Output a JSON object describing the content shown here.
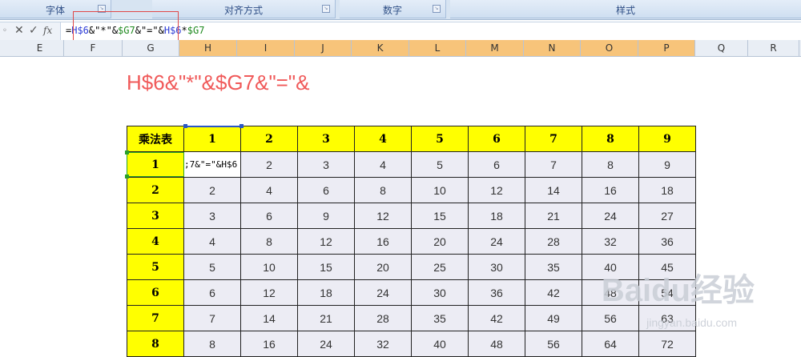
{
  "ribbon": {
    "groups": [
      "字体",
      "对齐方式",
      "数字",
      "样式"
    ]
  },
  "formula_bar": {
    "parts": [
      {
        "text": "=",
        "color": "#000000"
      },
      {
        "text": "H$6",
        "color": "#2b3bd6"
      },
      {
        "text": "&\"*\"&",
        "color": "#000000"
      },
      {
        "text": "$G7",
        "color": "#1f8a1f"
      },
      {
        "text": "&\"=\"&",
        "color": "#000000"
      },
      {
        "text": "H$6",
        "color": "#2b3bd6"
      },
      {
        "text": "*",
        "color": "#000000"
      },
      {
        "text": "$G7",
        "color": "#1f8a1f"
      }
    ]
  },
  "columns": [
    "E",
    "F",
    "G",
    "H",
    "I",
    "J",
    "K",
    "L",
    "M",
    "N",
    "O",
    "P",
    "Q",
    "R"
  ],
  "highlighted_columns": [
    "H",
    "I",
    "J",
    "K",
    "L",
    "M",
    "N",
    "O",
    "P"
  ],
  "big_text": "H$6&\"*\"&$G7&\"=\"&",
  "table": {
    "corner": "乘法表",
    "header": [
      "1",
      "2",
      "3",
      "4",
      "5",
      "6",
      "7",
      "8",
      "9"
    ],
    "editing_cell_text": ";7&\"=\"&H$6",
    "rows": [
      {
        "label": "1",
        "values": [
          "",
          "2",
          "3",
          "4",
          "5",
          "6",
          "7",
          "8",
          "9"
        ]
      },
      {
        "label": "2",
        "values": [
          "2",
          "4",
          "6",
          "8",
          "10",
          "12",
          "14",
          "16",
          "18"
        ]
      },
      {
        "label": "3",
        "values": [
          "3",
          "6",
          "9",
          "12",
          "15",
          "18",
          "21",
          "24",
          "27"
        ]
      },
      {
        "label": "4",
        "values": [
          "4",
          "8",
          "12",
          "16",
          "20",
          "24",
          "28",
          "32",
          "36"
        ]
      },
      {
        "label": "5",
        "values": [
          "5",
          "10",
          "15",
          "20",
          "25",
          "30",
          "35",
          "40",
          "45"
        ]
      },
      {
        "label": "6",
        "values": [
          "6",
          "12",
          "18",
          "24",
          "30",
          "36",
          "42",
          "48",
          "54"
        ]
      },
      {
        "label": "7",
        "values": [
          "7",
          "14",
          "21",
          "28",
          "35",
          "42",
          "49",
          "56",
          "63"
        ]
      },
      {
        "label": "8",
        "values": [
          "8",
          "16",
          "24",
          "32",
          "40",
          "48",
          "56",
          "64",
          "72"
        ]
      }
    ]
  },
  "watermark": {
    "logo": "Baidu经验",
    "url": "jingyan.baidu.com"
  }
}
